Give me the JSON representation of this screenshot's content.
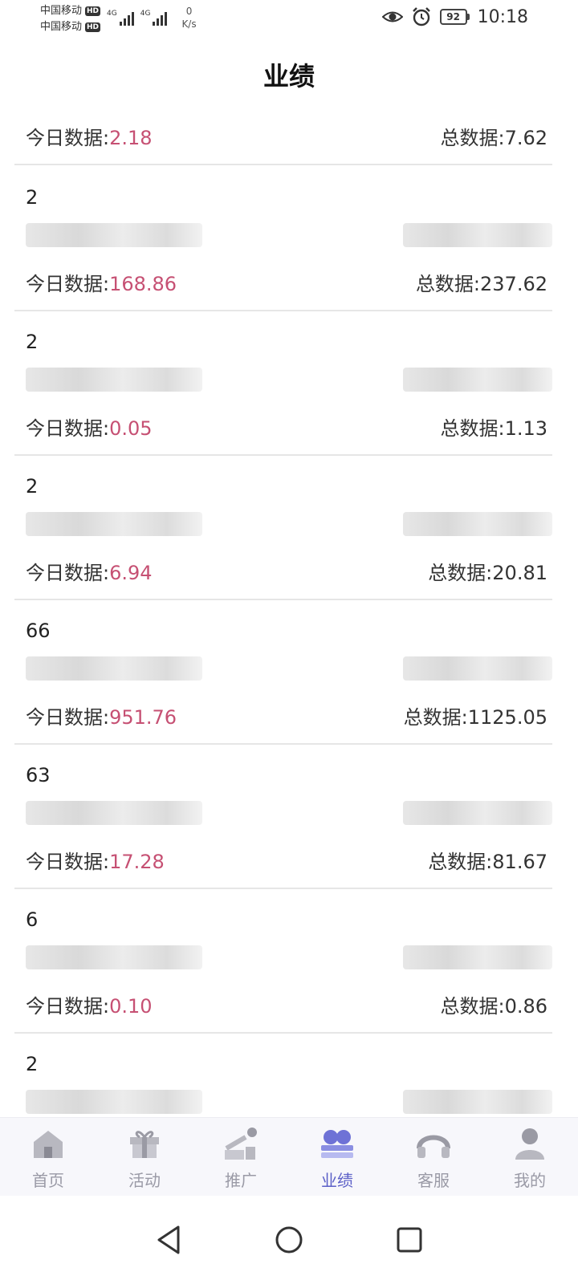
{
  "status_bar": {
    "carrier_1": "中国移动",
    "carrier_2": "中国移动",
    "hd_badge": "HD",
    "network_1": "4G",
    "network_2": "4G",
    "speed_value": "0",
    "speed_unit": "K/s",
    "battery": "92",
    "time": "10:18"
  },
  "page": {
    "title": "业绩"
  },
  "summary": {
    "today_label": "今日数据:",
    "today_value": "2.18",
    "total_label": "总数据:",
    "total_value": "7.62"
  },
  "records": [
    {
      "id": "2",
      "today_label": "今日数据:",
      "today": "168.86",
      "total_label": "总数据:",
      "total": "237.62"
    },
    {
      "id": "2",
      "today_label": "今日数据:",
      "today": "0.05",
      "total_label": "总数据:",
      "total": "1.13"
    },
    {
      "id": "2",
      "today_label": "今日数据:",
      "today": "6.94",
      "total_label": "总数据:",
      "total": "20.81"
    },
    {
      "id": "66",
      "today_label": "今日数据:",
      "today": "951.76",
      "total_label": "总数据:",
      "total": "1125.05"
    },
    {
      "id": "63",
      "today_label": "今日数据:",
      "today": "17.28",
      "total_label": "总数据:",
      "total": "81.67"
    },
    {
      "id": "6",
      "today_label": "今日数据:",
      "today": "0.10",
      "total_label": "总数据:",
      "total": "0.86"
    },
    {
      "id": "2",
      "today_label": "",
      "today": "",
      "total_label": "",
      "total": ""
    }
  ],
  "tabbar": {
    "items": [
      {
        "label": "首页",
        "icon": "home-icon"
      },
      {
        "label": "活动",
        "icon": "gift-icon"
      },
      {
        "label": "推广",
        "icon": "share-icon"
      },
      {
        "label": "业绩",
        "icon": "performance-icon",
        "active": true
      },
      {
        "label": "客服",
        "icon": "headset-icon"
      },
      {
        "label": "我的",
        "icon": "profile-icon"
      }
    ],
    "active_color": "#5b5fc7",
    "inactive_color": "#9a9aa6"
  },
  "colors": {
    "value_red": "#c65073"
  }
}
